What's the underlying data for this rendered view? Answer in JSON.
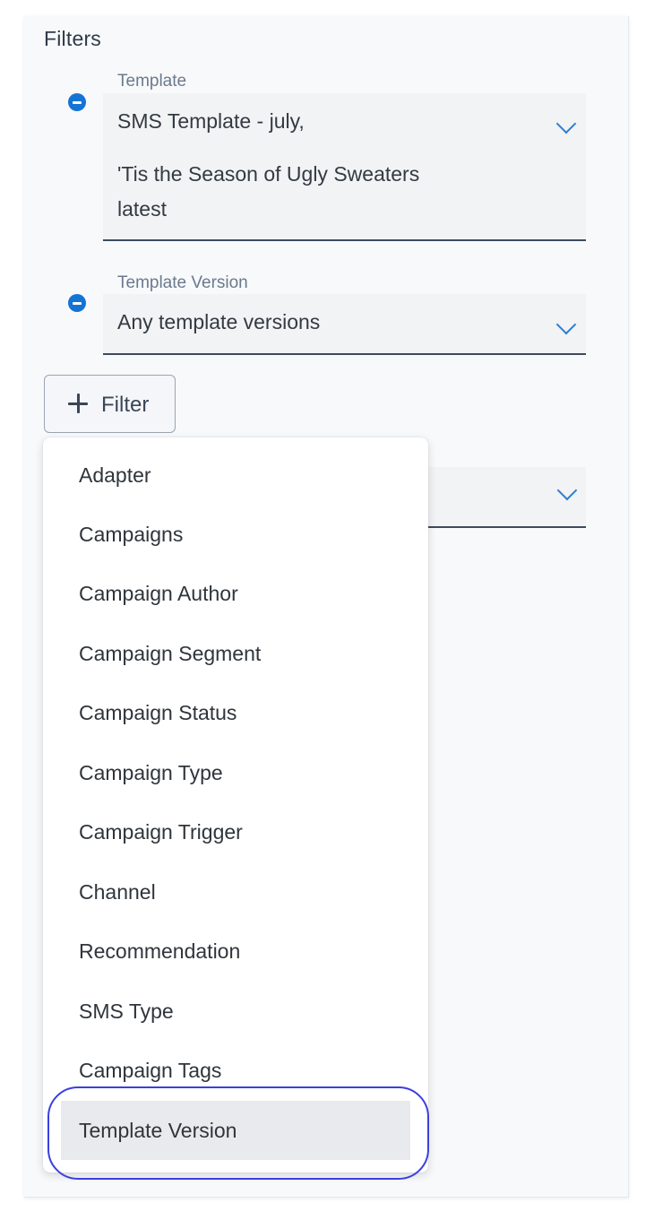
{
  "panel": {
    "title": "Filters"
  },
  "filters": [
    {
      "label": "Template",
      "value_line1": "SMS Template - july,",
      "value_line2": "'Tis the Season of Ugly Sweaters",
      "value_line3": "latest"
    },
    {
      "label": "Template Version",
      "value_line1": "Any template versions"
    }
  ],
  "add_filter": {
    "label": "Filter",
    "icon": "plus-icon"
  },
  "menu": {
    "items": [
      "Adapter",
      "Campaigns",
      "Campaign Author",
      "Campaign Segment",
      "Campaign Status",
      "Campaign Type",
      "Campaign Trigger",
      "Channel",
      "Recommendation",
      "SMS Type",
      "Campaign Tags",
      "Template Version"
    ],
    "highlighted_item": "Template Version"
  },
  "colors": {
    "accent": "#1474d4",
    "chevron": "#2f7fd1",
    "highlight_ring": "#3b3fe0",
    "highlight_bg": "#e9eaee"
  }
}
